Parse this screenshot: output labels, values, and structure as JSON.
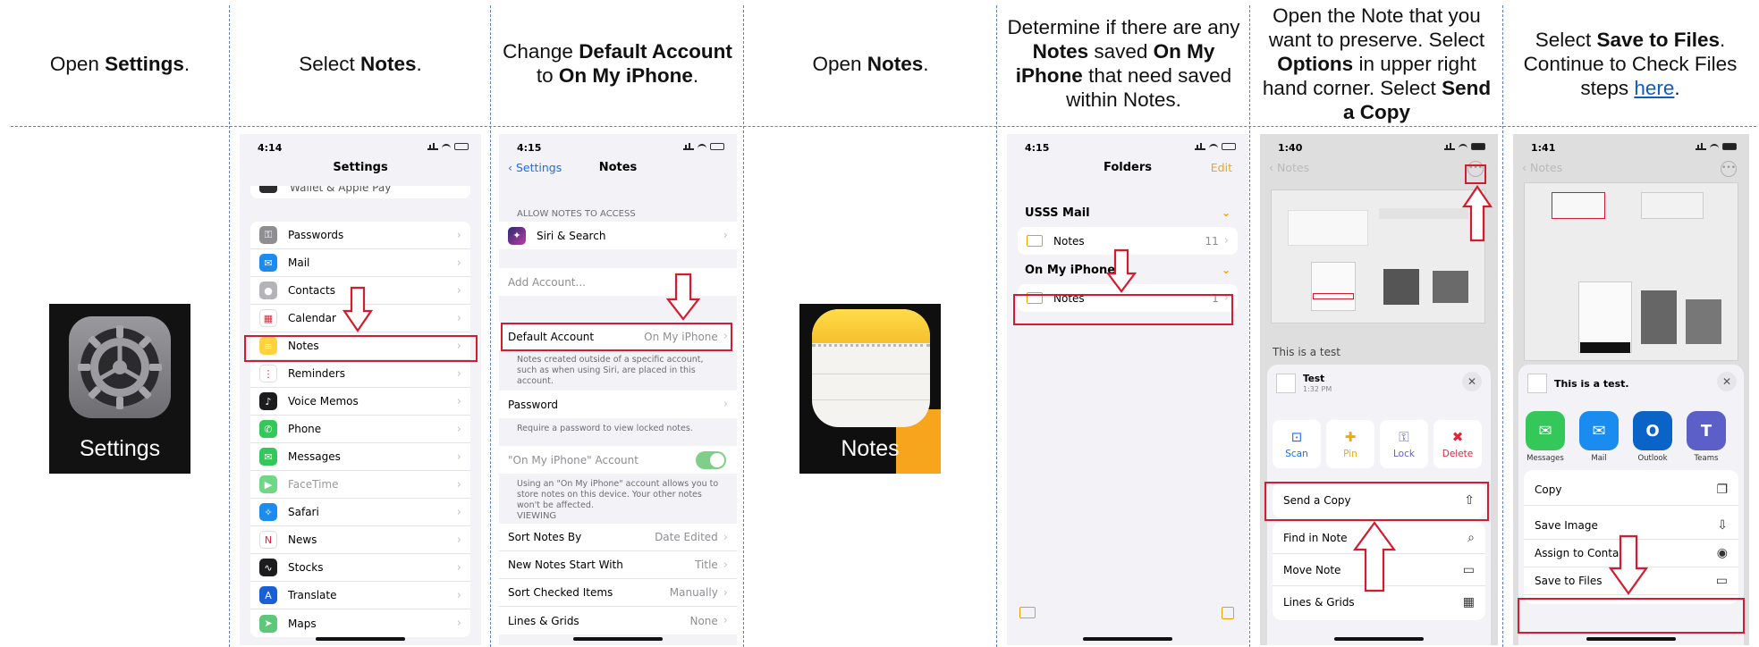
{
  "steps": [
    {
      "parts": [
        {
          "t": "Open "
        },
        {
          "t": "Settings",
          "b": true
        },
        {
          "t": "."
        }
      ]
    },
    {
      "parts": [
        {
          "t": "Select "
        },
        {
          "t": "Notes",
          "b": true
        },
        {
          "t": "."
        }
      ]
    },
    {
      "parts": [
        {
          "t": "Change "
        },
        {
          "t": "Default Account",
          "b": true
        },
        {
          "t": " to "
        },
        {
          "t": "On My iPhone",
          "b": true
        },
        {
          "t": "."
        }
      ]
    },
    {
      "parts": [
        {
          "t": "Open "
        },
        {
          "t": "Notes",
          "b": true
        },
        {
          "t": "."
        }
      ]
    },
    {
      "parts": [
        {
          "t": "Determine if there are any "
        },
        {
          "t": "Notes",
          "b": true
        },
        {
          "t": " saved "
        },
        {
          "t": "On My iPhone",
          "b": true
        },
        {
          "t": " that need saved within Notes."
        }
      ]
    },
    {
      "parts": [
        {
          "t": "Open the Note that you want to preserve. Select "
        },
        {
          "t": "Options",
          "b": true
        },
        {
          "t": " in upper right hand corner. Select "
        },
        {
          "t": "Send a Copy",
          "b": true
        }
      ]
    },
    {
      "parts": [
        {
          "t": "Select "
        },
        {
          "t": "Save to Files",
          "b": true
        },
        {
          "t": ". Continue to Check Files steps "
        },
        {
          "t": "here",
          "link": true
        },
        {
          "t": "."
        }
      ]
    }
  ],
  "settings_icon": {
    "label": "Settings",
    "icon": "gear-icon"
  },
  "notes_icon": {
    "label": "Notes",
    "icon": "notepad-icon"
  },
  "screen_settings": {
    "time": "4:14",
    "title": "Settings",
    "cut_item": "Wallet & Apple Pay",
    "items": [
      {
        "label": "Passwords",
        "color": "#8e8e93",
        "glyph": "⚿"
      },
      {
        "label": "Mail",
        "color": "#1a8cf0",
        "glyph": "✉"
      },
      {
        "label": "Contacts",
        "color": "#b4b4b8",
        "glyph": "●"
      },
      {
        "label": "Calendar",
        "color": "#ffffff",
        "glyph": "▦"
      },
      {
        "label": "Notes",
        "color": "#ffd23f",
        "glyph": "≡"
      },
      {
        "label": "Reminders",
        "color": "#ffffff",
        "glyph": "⋮"
      },
      {
        "label": "Voice Memos",
        "color": "#1c1c1e",
        "glyph": "♪"
      },
      {
        "label": "Phone",
        "color": "#34c759",
        "glyph": "✆"
      },
      {
        "label": "Messages",
        "color": "#34c759",
        "glyph": "✉"
      },
      {
        "label": "FaceTime",
        "color": "#6ed884",
        "glyph": "▶"
      },
      {
        "label": "Safari",
        "color": "#1a8cf0",
        "glyph": "✧"
      },
      {
        "label": "News",
        "color": "#ffffff",
        "glyph": "N"
      },
      {
        "label": "Stocks",
        "color": "#1c1c1e",
        "glyph": "∿"
      },
      {
        "label": "Translate",
        "color": "#1a5fd6",
        "glyph": "A"
      },
      {
        "label": "Maps",
        "color": "#5fc77a",
        "glyph": "➤"
      }
    ]
  },
  "screen_notes_settings": {
    "time": "4:15",
    "back": "Settings",
    "title": "Notes",
    "allow_header": "ALLOW NOTES TO ACCESS",
    "siri": "Siri & Search",
    "add_account": "Add Account...",
    "default_account": "Default Account",
    "default_value": "On My iPhone",
    "default_note": "Notes created outside of a specific account, such as when using Siri, are placed in this account.",
    "password": "Password",
    "password_note": "Require a password to view locked notes.",
    "onmy_account": "\"On My iPhone\" Account",
    "onmy_note": "Using an \"On My iPhone\" account allows you to store notes on this device. Your other notes won't be affected.",
    "viewing_header": "VIEWING",
    "viewing": [
      {
        "label": "Sort Notes By",
        "value": "Date Edited"
      },
      {
        "label": "New Notes Start With",
        "value": "Title"
      },
      {
        "label": "Sort Checked Items",
        "value": "Manually"
      },
      {
        "label": "Lines & Grids",
        "value": "None"
      }
    ]
  },
  "screen_folders": {
    "time": "4:15",
    "title": "Folders",
    "edit": "Edit",
    "sections": [
      {
        "name": "USSS Mail",
        "folder": "Notes",
        "count": "11"
      },
      {
        "name": "On My iPhone",
        "folder": "Notes",
        "count": "1"
      }
    ]
  },
  "screen_note": {
    "time": "1:40",
    "back": "Notes",
    "note_text": "This is a test",
    "sheet_title": "Test",
    "sheet_time": "1:32 PM",
    "actions": [
      {
        "label": "Scan",
        "color": "#1570ef",
        "glyph": "⊡"
      },
      {
        "label": "Pin",
        "color": "#f2a900",
        "glyph": "✚"
      },
      {
        "label": "Lock",
        "color": "#5e5ce6",
        "glyph": "⚿"
      },
      {
        "label": "Delete",
        "color": "#e0243a",
        "glyph": "✖"
      }
    ],
    "send_copy": "Send a Copy",
    "menu": [
      {
        "label": "Find in Note",
        "glyph": "⌕"
      },
      {
        "label": "Move Note",
        "glyph": "▭"
      },
      {
        "label": "Lines & Grids",
        "glyph": "▦"
      }
    ]
  },
  "screen_share": {
    "time": "1:41",
    "back": "Notes",
    "sheet_title": "This is a test.",
    "apps": [
      {
        "label": "Messages",
        "color": "#34c759",
        "glyph": "✉"
      },
      {
        "label": "Mail",
        "color": "#1a8cf0",
        "glyph": "✉"
      },
      {
        "label": "Outlook",
        "color": "#0a64c8",
        "glyph": "O"
      },
      {
        "label": "Teams",
        "color": "#5b5fc7",
        "glyph": "T"
      }
    ],
    "actions": [
      {
        "label": "Copy",
        "glyph": "❐"
      },
      {
        "label": "Save Image",
        "glyph": "⇩"
      },
      {
        "label": "Assign to Contact",
        "glyph": "◉"
      },
      {
        "label": "Save to Files",
        "glyph": "▭"
      }
    ]
  }
}
